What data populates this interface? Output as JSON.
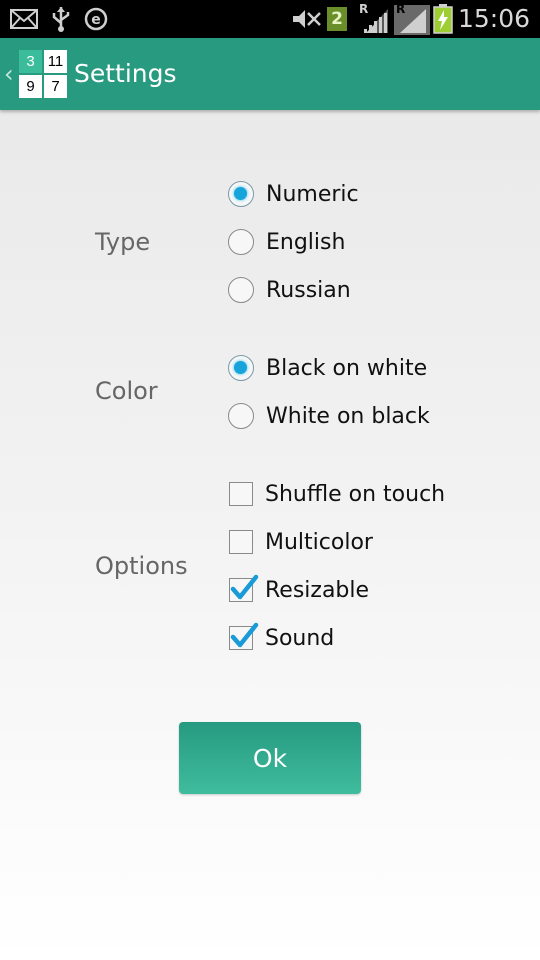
{
  "status_bar": {
    "time": "15:06",
    "sim_badge": "2",
    "roaming_indicator_1": "R",
    "roaming_indicator_2": "R",
    "icons": [
      "mail-icon",
      "usb-icon",
      "e-icon",
      "mute-icon",
      "sim2-icon",
      "signal-icon",
      "signal-icon",
      "battery-icon"
    ]
  },
  "action_bar": {
    "title": "Settings",
    "logo_cells": [
      "3",
      "11",
      "9",
      "7"
    ],
    "accent_color": "#289a7f"
  },
  "groups": {
    "type": {
      "label": "Type",
      "options": [
        {
          "label": "Numeric",
          "selected": true
        },
        {
          "label": "English",
          "selected": false
        },
        {
          "label": "Russian",
          "selected": false
        }
      ]
    },
    "color": {
      "label": "Color",
      "options": [
        {
          "label": "Black on white",
          "selected": true
        },
        {
          "label": "White on black",
          "selected": false
        }
      ]
    },
    "options": {
      "label": "Options",
      "items": [
        {
          "label": "Shuffle on touch",
          "checked": false
        },
        {
          "label": "Multicolor",
          "checked": false
        },
        {
          "label": "Resizable",
          "checked": true
        },
        {
          "label": "Sound",
          "checked": true
        }
      ]
    }
  },
  "ok_button": {
    "label": "Ok"
  },
  "colors": {
    "radio_selected": "#17a4da",
    "check_mark": "#1a9ad6",
    "button": "#2fa98c"
  }
}
